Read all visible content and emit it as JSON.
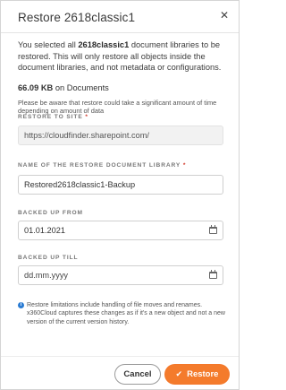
{
  "dialog": {
    "title": "Restore 2618classic1",
    "close_icon": "close-icon"
  },
  "intro": {
    "before": "You selected all ",
    "library_bold": "2618classic1",
    "after": " document libraries to be restored. This will only restore all objects inside the document libraries, and not metadata or configurations."
  },
  "size": {
    "amount": "66.09 KB",
    "suffix": " on Documents"
  },
  "warning": "Please be aware that restore could take a significant amount of time depending on amount of data",
  "restore_to_site": {
    "label": "RESTORE TO SITE",
    "required_mark": "*",
    "value": "https://cloudfinder.sharepoint.com/"
  },
  "library_name": {
    "label": "NAME OF THE RESTORE DOCUMENT LIBRARY",
    "required_mark": "*",
    "value": "Restored2618classic1-Backup"
  },
  "backed_up_from": {
    "label": "BACKED UP FROM",
    "value": "01.01.2021",
    "icon": "calendar-icon"
  },
  "backed_up_till": {
    "label": "BACKED UP TILL",
    "placeholder": "dd.mm.yyyy",
    "icon": "calendar-icon"
  },
  "info": {
    "icon": "info-icon",
    "text": "Restore limitations include handling of file moves and renames. x360Cloud captures these changes as if it's a new object and not a new version of the current version history."
  },
  "buttons": {
    "cancel": "Cancel",
    "restore": "Restore",
    "restore_icon": "check-icon"
  },
  "colors": {
    "accent": "#f47b2c",
    "required": "#d23a2a",
    "info": "#2b7cd3"
  }
}
